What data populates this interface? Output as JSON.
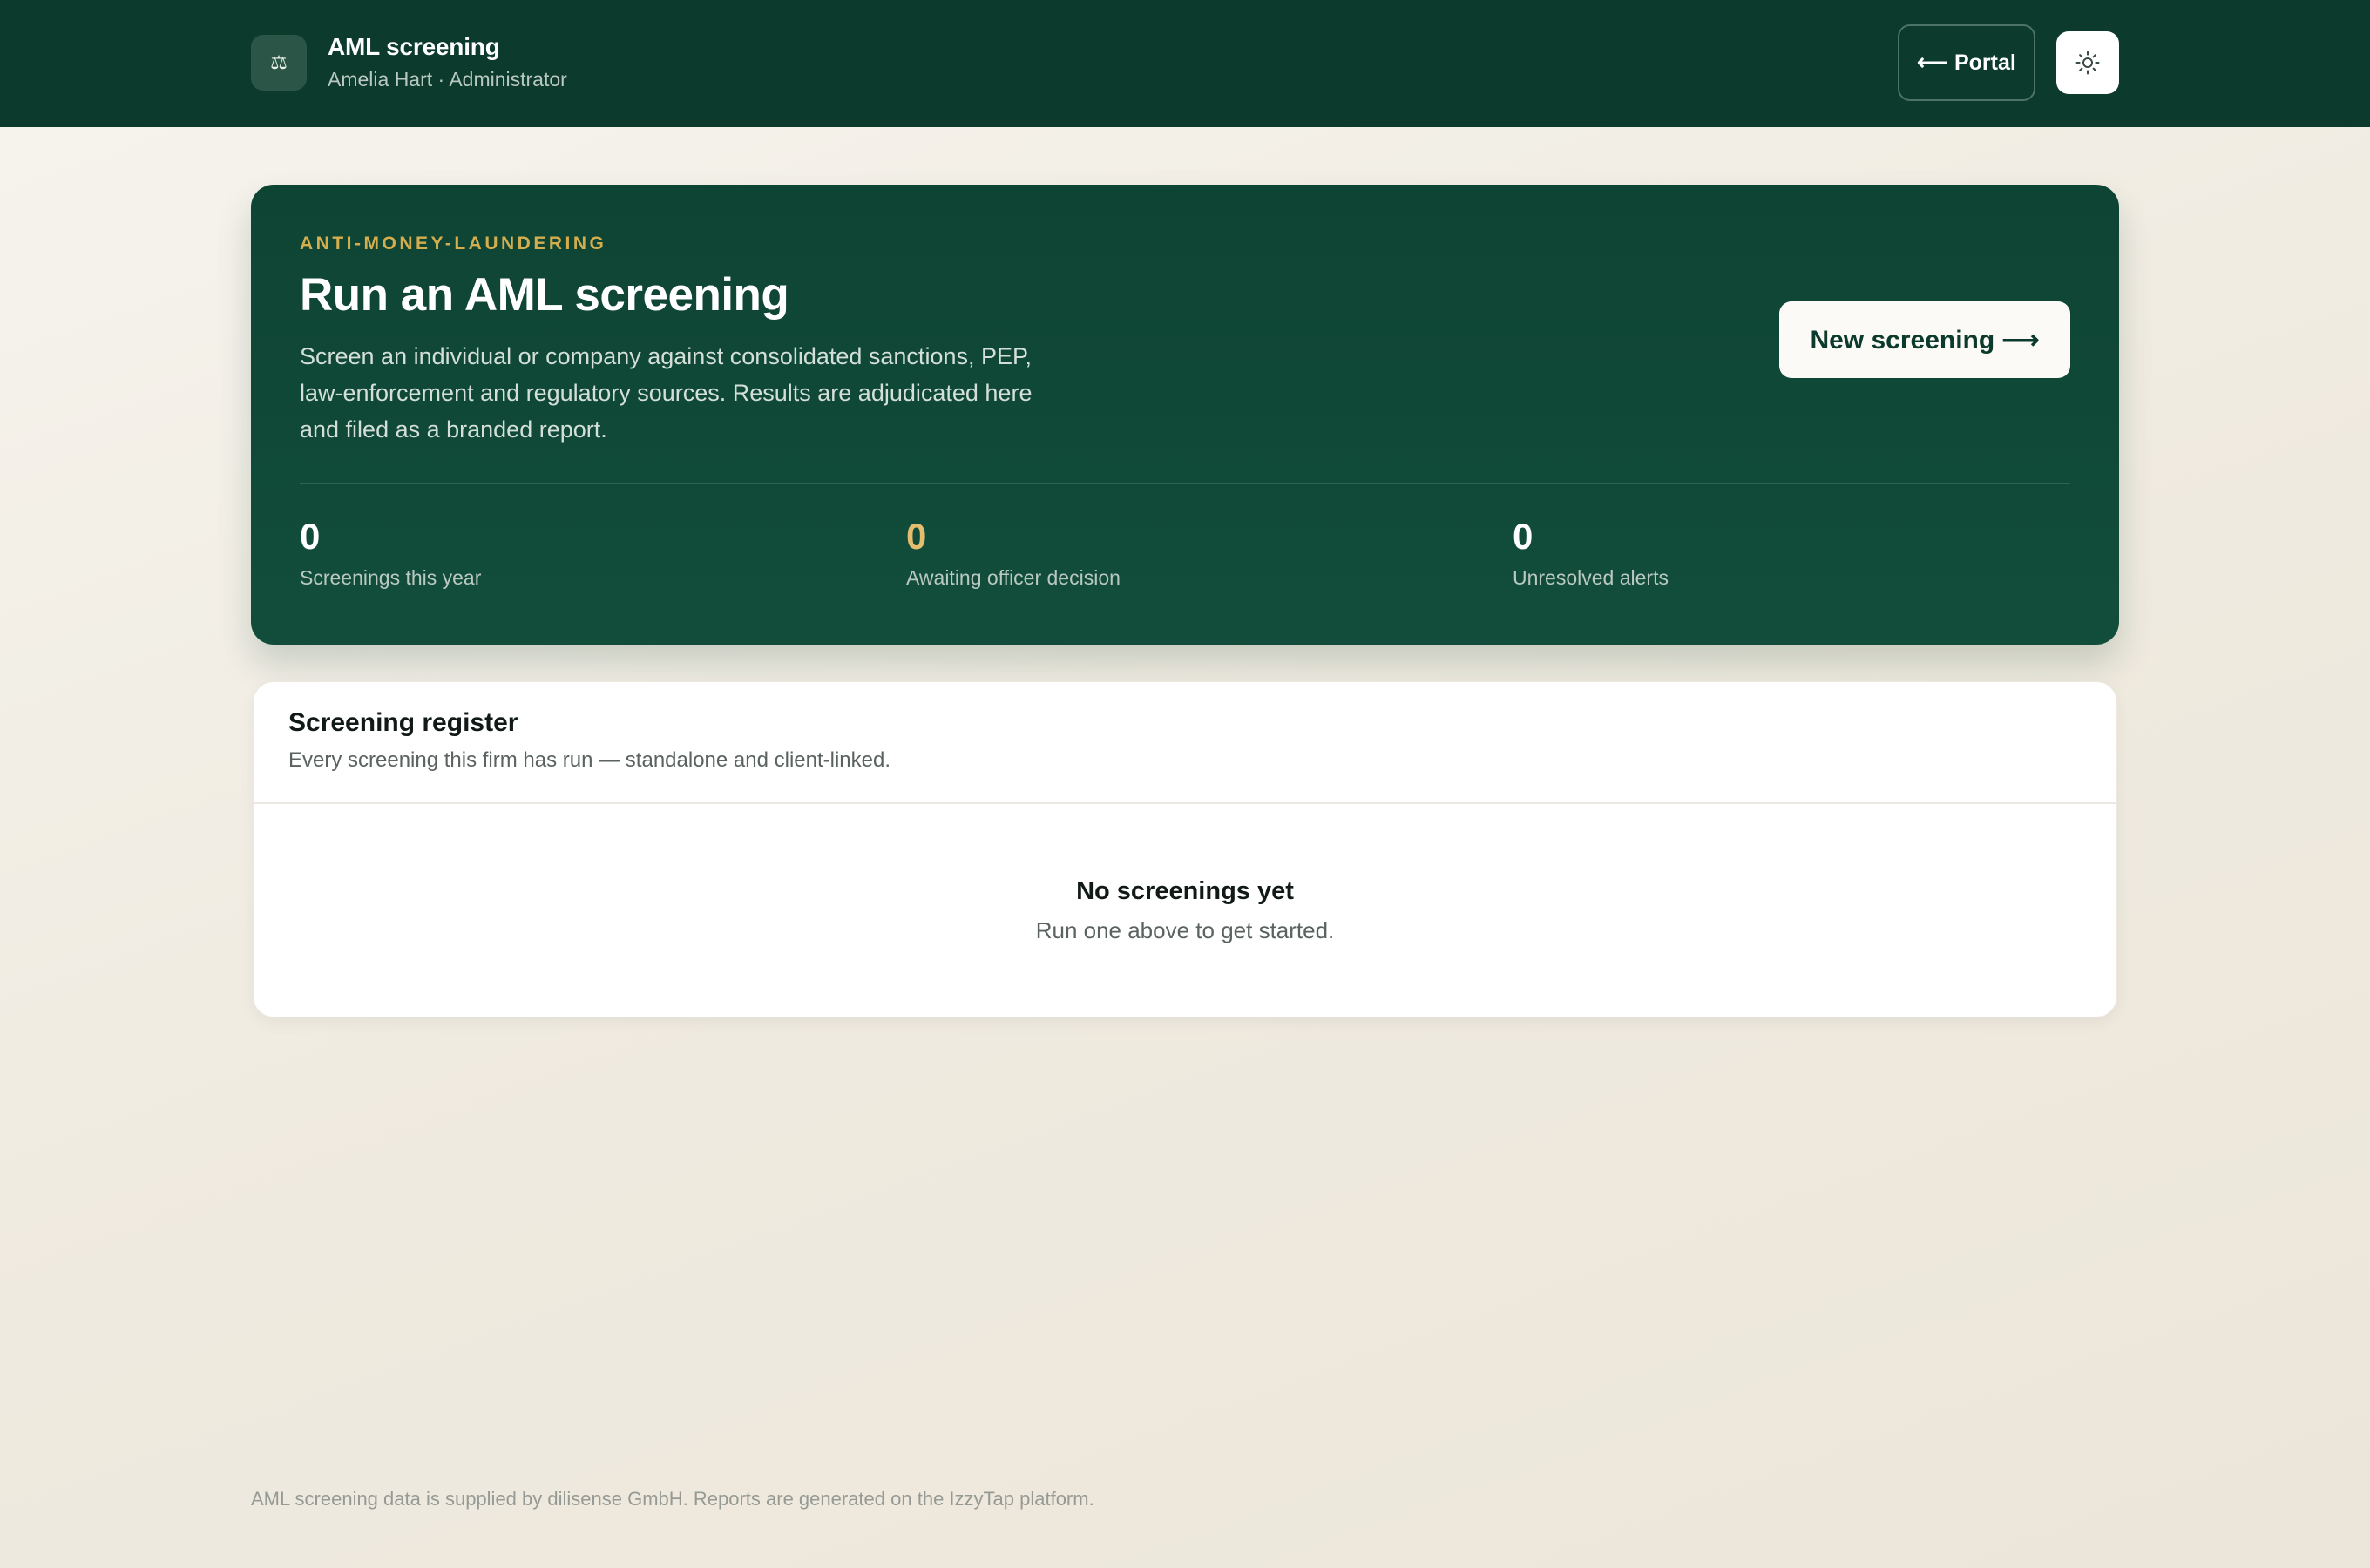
{
  "header": {
    "brand_icon": "scales-icon",
    "brand_glyph": "⚖",
    "title": "AML screening",
    "subtitle": "Amelia Hart · Administrator",
    "portal_label": "⟵ Portal",
    "theme_icon": "sun-icon"
  },
  "hero": {
    "eyebrow": "ANTI-MONEY-LAUNDERING",
    "title": "Run an AML screening",
    "description": "Screen an individual or company against consolidated sanctions, PEP, law-enforcement and regulatory sources. Results are adjudicated here and filed as a branded report.",
    "cta_label": "New screening ⟶",
    "stats": [
      {
        "value": "0",
        "label": "Screenings this year"
      },
      {
        "value": "0",
        "label": "Awaiting officer decision"
      },
      {
        "value": "0",
        "label": "Unresolved alerts"
      }
    ]
  },
  "register": {
    "title": "Screening register",
    "subtitle": "Every screening this firm has run — standalone and client-linked.",
    "empty_title": "No screenings yet",
    "empty_subtitle": "Run one above to get started."
  },
  "footer": {
    "text": "AML screening data is supplied by dilisense GmbH. Reports are generated on the IzzyTap platform."
  },
  "colors": {
    "header_bg": "#0c3a2c",
    "hero_bg": "#0e4434",
    "eyebrow": "#d4ae4e",
    "amber_stat": "#e5bd6e"
  }
}
